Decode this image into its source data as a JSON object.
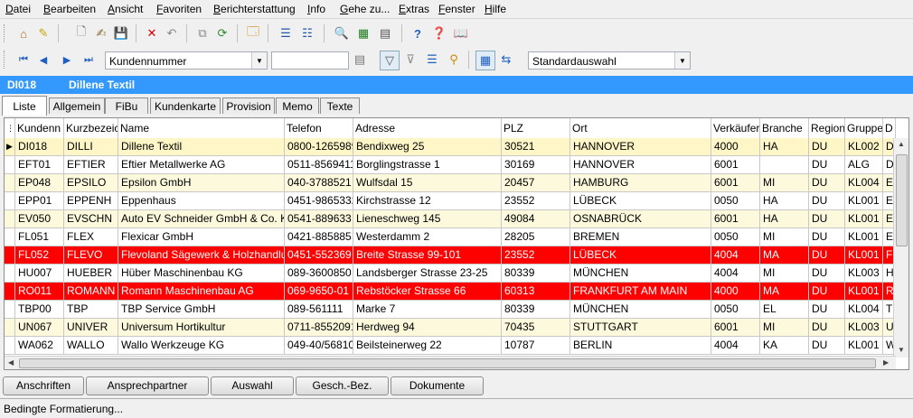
{
  "menu": [
    "Datei",
    "Bearbeiten",
    "Ansicht",
    "Favoriten",
    "Berichterstattung",
    "Info",
    "Gehe zu...",
    "Extras",
    "Fenster",
    "Hilfe"
  ],
  "toolbar2": {
    "field_select": "Kundennummer",
    "search_value": "",
    "selection": "Standardauswahl"
  },
  "record": {
    "id": "DI018",
    "name": "Dillene Textil"
  },
  "tabs": [
    "Liste",
    "Allgemein",
    "FiBu",
    "Kundenkarte",
    "Provision",
    "Memo",
    "Texte"
  ],
  "columns": [
    "Kundenn",
    "Kurzbezeic",
    "Name",
    "Telefon",
    "Adresse",
    "PLZ",
    "Ort",
    "Verkäufer",
    "Branche",
    "Region",
    "Gruppe",
    "D"
  ],
  "rows": [
    [
      "DI018",
      "DILLI",
      "Dillene Textil",
      "0800-1265989",
      "Bendixweg 25",
      "30521",
      "HANNOVER",
      "4000",
      "HA",
      "DU",
      "KL002",
      "D"
    ],
    [
      "EFT01",
      "EFTIER",
      "Eftier Metallwerke AG",
      "0511-8569411",
      "Borglingstrasse 1",
      "30169",
      "HANNOVER",
      "6001",
      "",
      "DU",
      "ALG",
      "D"
    ],
    [
      "EP048",
      "EPSILO",
      "Epsilon GmbH",
      "040-3788521",
      "Wulfsdal 15",
      "20457",
      "HAMBURG",
      "6001",
      "MI",
      "DU",
      "KL004",
      "E"
    ],
    [
      "EPP01",
      "EPPENH",
      "Eppenhaus",
      "0451-9865332",
      "Kirchstrasse 12",
      "23552",
      "LÜBECK",
      "0050",
      "HA",
      "DU",
      "KL001",
      "E"
    ],
    [
      "EV050",
      "EVSCHN",
      "Auto EV Schneider GmbH & Co. K",
      "0541-889633",
      "Lieneschweg 145",
      "49084",
      "OSNABRÜCK",
      "6001",
      "HA",
      "DU",
      "KL001",
      "E"
    ],
    [
      "FL051",
      "FLEX",
      "Flexicar GmbH",
      "0421-885885",
      "Westerdamm 2",
      "28205",
      "BREMEN",
      "0050",
      "MI",
      "DU",
      "KL001",
      "E"
    ],
    [
      "FL052",
      "FLEVO",
      "Flevoland Sägewerk & Holzhandlu",
      "0451-552369",
      "Breite Strasse 99-101",
      "23552",
      "LÜBECK",
      "4004",
      "MA",
      "DU",
      "KL001",
      "F"
    ],
    [
      "HU007",
      "HUEBER",
      "Hüber Maschinenbau KG",
      "089-3600850",
      "Landsberger Strasse 23-25",
      "80339",
      "MÜNCHEN",
      "4004",
      "MI",
      "DU",
      "KL003",
      "H"
    ],
    [
      "RO011",
      "ROMANN",
      "Romann Maschinenbau AG",
      "069-9650-01",
      "Rebstöcker Strasse 66",
      "60313",
      "FRANKFURT AM MAIN",
      "4000",
      "MA",
      "DU",
      "KL001",
      "R"
    ],
    [
      "TBP00",
      "TBP",
      "TBP Service GmbH",
      "089-561111",
      "Marke 7",
      "80339",
      "MÜNCHEN",
      "0050",
      "EL",
      "DU",
      "KL004",
      "T"
    ],
    [
      "UN067",
      "UNIVER",
      "Universum Hortikultur",
      "0711-8552091",
      "Herdweg 94",
      "70435",
      "STUTTGART",
      "6001",
      "MI",
      "DU",
      "KL003",
      "U"
    ],
    [
      "WA062",
      "WALLO",
      "Wallo Werkzeuge KG",
      "049-40/568100",
      "Beilsteinerweg 22",
      "10787",
      "BERLIN",
      "4004",
      "KA",
      "DU",
      "KL001",
      "W"
    ]
  ],
  "row_styles": [
    "sel",
    "white",
    "alt",
    "white",
    "alt",
    "white",
    "red",
    "white",
    "red",
    "white",
    "alt",
    "white"
  ],
  "bottom_buttons": [
    "Anschriften",
    "Ansprechpartner",
    "Auswahl",
    "Gesch.-Bez.",
    "Dokumente"
  ],
  "status": "Bedingte Formatierung...",
  "colors": {
    "header_blue": "#3399ff",
    "highlight_red": "#ff0000",
    "row_alt": "#fcf9dc"
  }
}
